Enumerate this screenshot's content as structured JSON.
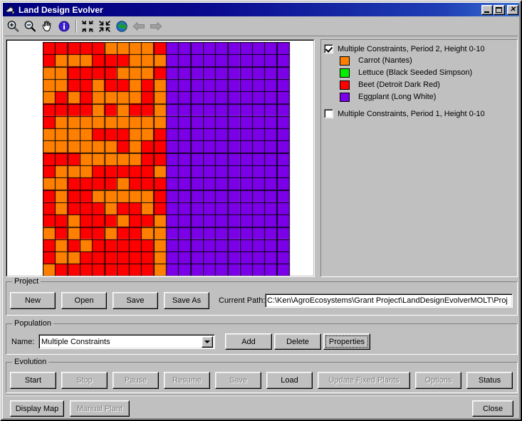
{
  "window": {
    "title": "Land Design Evolver",
    "icon": "app-icon",
    "buttons": {
      "minimize": "_",
      "maximize": "□",
      "close": "✕"
    }
  },
  "toolbar": {
    "items": [
      {
        "name": "zoom-in-icon",
        "tooltip": "Zoom In"
      },
      {
        "name": "zoom-out-icon",
        "tooltip": "Zoom Out"
      },
      {
        "name": "pan-hand-icon",
        "tooltip": "Pan"
      },
      {
        "name": "info-icon",
        "tooltip": "Info"
      },
      {
        "name": "zoom-to-fit-icon",
        "tooltip": "Zoom To Fit"
      },
      {
        "name": "zoom-full-extent-icon",
        "tooltip": "Full Extent"
      },
      {
        "name": "globe-icon",
        "tooltip": "Globe"
      },
      {
        "name": "back-arrow-icon",
        "tooltip": "Previous View"
      },
      {
        "name": "forward-arrow-icon",
        "tooltip": "Next View"
      }
    ]
  },
  "legend": {
    "layers": [
      {
        "label": "Multiple Constraints, Period 2, Height 0-10",
        "checked": true,
        "entries": [
          {
            "color": "#FF8000",
            "label": "Carrot (Nantes)"
          },
          {
            "color": "#00EE00",
            "label": "Lettuce (Black Seeded Simpson)"
          },
          {
            "color": "#FF0000",
            "label": "Beet (Detroit Dark Red)"
          },
          {
            "color": "#7B00E8",
            "label": "Eggplant (Long White)"
          }
        ]
      },
      {
        "label": "Multiple Constraints, Period 1, Height 0-10",
        "checked": false,
        "entries": []
      }
    ]
  },
  "map": {
    "cols": 20,
    "rows": 19,
    "cell_size": 17.3,
    "colors": {
      "carrot": "#FF8000",
      "beet": "#FF0000",
      "eggplant": "#7B00E8"
    },
    "eggplant_start_col": 10,
    "seed": 20250411
  },
  "project": {
    "group_title": "Project",
    "buttons": [
      {
        "label": "New",
        "name": "new-project-button",
        "disabled": false
      },
      {
        "label": "Open",
        "name": "open-project-button",
        "disabled": false
      },
      {
        "label": "Save",
        "name": "save-project-button",
        "disabled": false
      },
      {
        "label": "Save As",
        "name": "save-as-project-button",
        "disabled": false
      }
    ],
    "path_label": "Current Path:",
    "path_value": "C:\\Ken\\AgroEcosystems\\Grant Project\\LandDesignEvolverMOLT\\Proj"
  },
  "population": {
    "group_title": "Population",
    "name_label": "Name:",
    "name_value": "Multiple Constraints",
    "buttons": [
      {
        "label": "Add",
        "name": "add-population-button",
        "disabled": false,
        "focused": false
      },
      {
        "label": "Delete",
        "name": "delete-population-button",
        "disabled": false,
        "focused": false
      },
      {
        "label": "Properties",
        "name": "properties-population-button",
        "disabled": false,
        "focused": true
      }
    ]
  },
  "evolution": {
    "group_title": "Evolution",
    "buttons": [
      {
        "label": "Start",
        "name": "start-button",
        "disabled": false
      },
      {
        "label": "Stop",
        "name": "stop-button",
        "disabled": true
      },
      {
        "label": "Pause",
        "name": "pause-button",
        "disabled": true
      },
      {
        "label": "Resume",
        "name": "resume-button",
        "disabled": true
      },
      {
        "label": "Save",
        "name": "save-evolution-button",
        "disabled": true
      },
      {
        "label": "Load",
        "name": "load-evolution-button",
        "disabled": false
      },
      {
        "label": "Update Fixed Plants",
        "name": "update-fixed-plants-button",
        "disabled": true
      },
      {
        "label": "Options",
        "name": "options-button",
        "disabled": true
      },
      {
        "label": "Status",
        "name": "status-button",
        "disabled": false
      }
    ]
  },
  "footer": {
    "buttons": [
      {
        "label": "Display Map",
        "name": "display-map-button",
        "disabled": false
      },
      {
        "label": "Manual Plant",
        "name": "manual-plant-button",
        "disabled": true
      },
      {
        "label": "Close",
        "name": "close-button",
        "disabled": false
      }
    ]
  }
}
